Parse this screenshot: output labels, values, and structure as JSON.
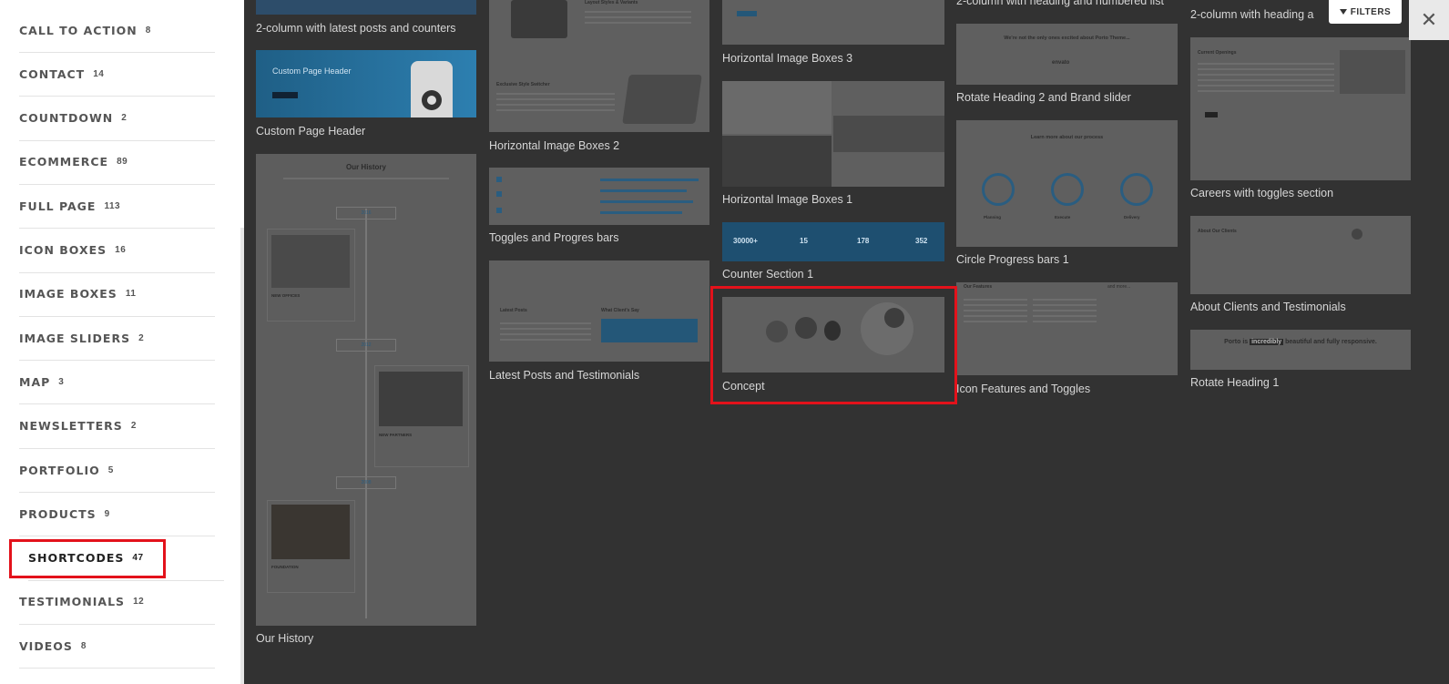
{
  "sidebar": {
    "categories": [
      {
        "label": "CALL TO ACTION",
        "count": "8"
      },
      {
        "label": "CONTACT",
        "count": "14"
      },
      {
        "label": "COUNTDOWN",
        "count": "2"
      },
      {
        "label": "ECOMMERCE",
        "count": "89"
      },
      {
        "label": "FULL PAGE",
        "count": "113"
      },
      {
        "label": "ICON BOXES",
        "count": "16"
      },
      {
        "label": "IMAGE BOXES",
        "count": "11"
      },
      {
        "label": "IMAGE SLIDERS",
        "count": "2"
      },
      {
        "label": "MAP",
        "count": "3"
      },
      {
        "label": "NEWSLETTERS",
        "count": "2"
      },
      {
        "label": "PORTFOLIO",
        "count": "5"
      },
      {
        "label": "PRODUCTS",
        "count": "9"
      },
      {
        "label": "SHORTCODES",
        "count": "47"
      },
      {
        "label": "TESTIMONIALS",
        "count": "12"
      },
      {
        "label": "VIDEOS",
        "count": "8"
      }
    ]
  },
  "toolbar": {
    "filters_label": "FILTERS",
    "close_label": "✕"
  },
  "templates": {
    "col1": [
      "2-column with latest posts and counters",
      "Custom Page Header",
      "Our History"
    ],
    "col2": [
      "Horizontal Image Boxes 2",
      "Toggles and Progres bars",
      "Latest Posts and Testimonials"
    ],
    "col3": [
      "Horizontal Image Boxes 3",
      "Horizontal Image Boxes 1",
      "Counter Section 1",
      "Concept"
    ],
    "col4": [
      "2-column with heading and numbered list",
      "Rotate Heading 2 and Brand slider",
      "Circle Progress bars 1",
      "Icon Features and Toggles"
    ],
    "col5": [
      "2-column with heading a",
      "Careers with toggles section",
      "About Clients and Testimonials",
      "Rotate Heading 1"
    ]
  },
  "thumb_text": {
    "custom_header": "Custom Page Header",
    "history_title": "Our History",
    "history_years": [
      "2016",
      "2012",
      "2008"
    ],
    "history_items": [
      "NEW OFFICES",
      "NEW PARTNERS",
      "FOUNDATION"
    ],
    "counters": [
      "30000+",
      "15",
      "178",
      "352"
    ],
    "rotate_heading_brands": "We're not the only ones excited about Porto Theme...",
    "brand_envato": "envato",
    "circle_heading": "Learn more about our process",
    "circle_labels": [
      "Planning",
      "Execute",
      "Delivery"
    ],
    "features_heading": "Our Features",
    "features_more": "and more...",
    "careers_heading": "Current Openings",
    "clients_heading": "About Our Clients",
    "rotate1_pre": "Porto is",
    "rotate1_word": "incredibly",
    "rotate1_post": "beautiful and fully responsive.",
    "latest_posts": "Latest Posts",
    "what_clients_say": "What Client's Say",
    "exclusive": "Exclusive Style Switcher",
    "layout": "Layout Styles & Variants"
  }
}
